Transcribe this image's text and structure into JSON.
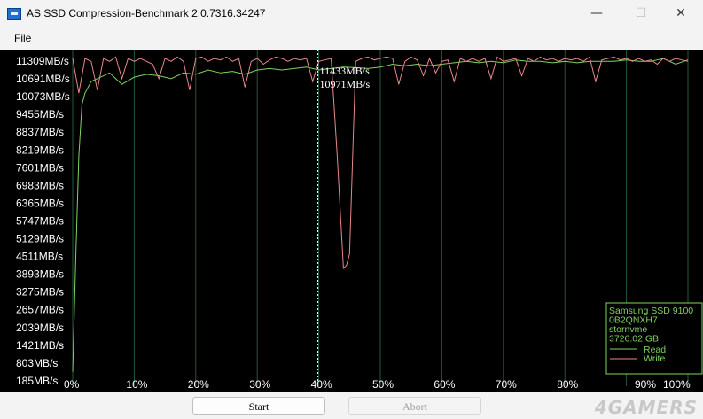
{
  "window": {
    "title": "AS SSD Compression-Benchmark 2.0.7316.34247",
    "minimize_icon": "minimize-icon",
    "maximize_icon": "maximize-icon",
    "close_icon": "close-icon"
  },
  "menu": {
    "file": "File"
  },
  "buttons": {
    "start": "Start",
    "abort": "Abort",
    "abort_enabled": false
  },
  "watermark": "4GAMERS",
  "colors": {
    "background": "#000000",
    "grid": "#1f5a3a",
    "read": "#7fd460",
    "write": "#e88888",
    "legend_text": "#7fd460",
    "label_text": "#ffffff",
    "cursor_text": "#ffffff"
  },
  "chart_data": {
    "type": "line",
    "ylabel_ticks": [
      "11309MB/s",
      "10691MB/s",
      "10073MB/s",
      "9455MB/s",
      "8837MB/s",
      "8219MB/s",
      "7601MB/s",
      "6983MB/s",
      "6365MB/s",
      "5747MB/s",
      "5129MB/s",
      "4511MB/s",
      "3893MB/s",
      "3275MB/s",
      "2657MB/s",
      "2039MB/s",
      "1421MB/s",
      "803MB/s",
      "185MB/s"
    ],
    "xlabel_ticks": [
      "0%",
      "10%",
      "20%",
      "30%",
      "40%",
      "50%",
      "60%",
      "70%",
      "80%",
      "90%",
      "100%"
    ],
    "ylim": [
      185,
      11800
    ],
    "xlim": [
      0,
      100
    ],
    "cursor": {
      "x": 41,
      "read_label": "11433MB/s",
      "write_label": "10971MB/s"
    },
    "legend": {
      "drive": "Samsung SSD 9100",
      "firmware": "0B2QNXH7",
      "driver": "stornvme",
      "size": "3726.02 GB",
      "read_label": "Read",
      "write_label": "Write",
      "placement": "bottom-right"
    },
    "series": [
      {
        "name": "Read",
        "x": [
          0,
          0.5,
          1,
          1.5,
          2,
          3,
          4,
          6,
          8,
          10,
          12,
          14,
          16,
          18,
          20,
          22,
          24,
          26,
          28,
          30,
          32,
          34,
          36,
          38,
          40,
          42,
          44,
          46,
          48,
          50,
          52,
          54,
          56,
          58,
          60,
          62,
          64,
          66,
          68,
          70,
          72,
          74,
          76,
          78,
          80,
          82,
          84,
          86,
          88,
          90,
          92,
          94,
          96,
          98,
          100
        ],
        "values": [
          500,
          4500,
          8000,
          9800,
          10200,
          10600,
          10700,
          10900,
          10500,
          10750,
          10850,
          10800,
          10700,
          10900,
          10850,
          11000,
          10900,
          10950,
          10850,
          11000,
          11050,
          11000,
          11050,
          11100,
          11000,
          11050,
          11100,
          11080,
          11050,
          11100,
          11200,
          11150,
          11200,
          11150,
          11200,
          11250,
          11300,
          11250,
          11300,
          11250,
          11350,
          11300,
          11300,
          11250,
          11300,
          11250,
          11300,
          11300,
          11300,
          11350,
          11300,
          11300,
          11400,
          11200,
          11350
        ]
      },
      {
        "name": "Write",
        "x": [
          0,
          1,
          2,
          3,
          4,
          5,
          6,
          7,
          8,
          9,
          10,
          11,
          12,
          13,
          14,
          15,
          16,
          17,
          18,
          19,
          20,
          21,
          22,
          23,
          24,
          25,
          26,
          27,
          28,
          29,
          30,
          31,
          32,
          33,
          34,
          35,
          36,
          37,
          38,
          39,
          40,
          41,
          42,
          43,
          44,
          44.5,
          45,
          46,
          47,
          48,
          49,
          50,
          51,
          52,
          53,
          54,
          55,
          56,
          57,
          58,
          59,
          60,
          61,
          62,
          63,
          64,
          65,
          66,
          67,
          68,
          69,
          70,
          71,
          72,
          73,
          74,
          75,
          76,
          77,
          78,
          79,
          80,
          81,
          82,
          83,
          84,
          85,
          86,
          87,
          88,
          89,
          90,
          91,
          92,
          93,
          94,
          95,
          96,
          97,
          98,
          99,
          100
        ],
        "values": [
          11400,
          10200,
          11400,
          11300,
          10300,
          11400,
          11300,
          11450,
          10700,
          11400,
          11300,
          11400,
          11300,
          11200,
          10700,
          11400,
          11300,
          11450,
          11300,
          10300,
          11400,
          11450,
          11300,
          11400,
          11350,
          11450,
          11300,
          11400,
          10400,
          11300,
          11400,
          11200,
          11350,
          11450,
          11400,
          11300,
          11400,
          11350,
          11400,
          10600,
          11300,
          11350,
          11400,
          8000,
          4100,
          4200,
          4600,
          11300,
          11400,
          11450,
          11350,
          11400,
          11450,
          11400,
          10500,
          11300,
          11450,
          11350,
          10800,
          11400,
          10900,
          11300,
          11350,
          10600,
          11400,
          11300,
          11400,
          11300,
          11400,
          10700,
          11450,
          11300,
          11350,
          11400,
          10800,
          11400,
          11300,
          11450,
          11350,
          11400,
          11300,
          11400,
          11350,
          11400,
          11300,
          11450,
          10600,
          11350,
          11400,
          11450,
          11350,
          11400,
          11300,
          11400,
          11300,
          11350,
          11200,
          11400,
          11300,
          11400,
          11350,
          11300
        ]
      }
    ]
  }
}
